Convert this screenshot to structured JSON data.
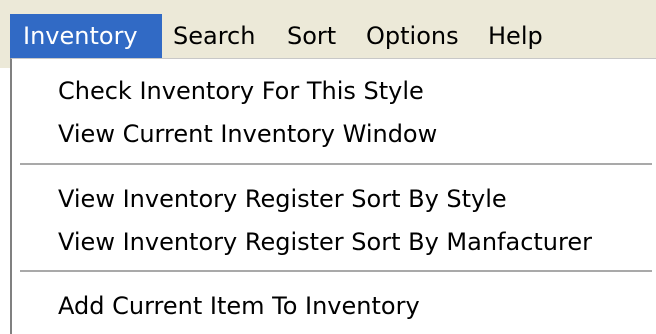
{
  "menubar": {
    "items": [
      {
        "label": "Inventory"
      },
      {
        "label": "Search"
      },
      {
        "label": "Sort"
      },
      {
        "label": "Options"
      },
      {
        "label": "Help"
      }
    ],
    "active": "Inventory"
  },
  "dropdown": {
    "items": [
      {
        "label": "Check Inventory For This Style"
      },
      {
        "label": "View Current Inventory Window"
      },
      {
        "label": "View Inventory Register Sort By Style"
      },
      {
        "label": "View Inventory Register Sort By Manfacturer"
      },
      {
        "label": "Add Current Item To Inventory"
      }
    ]
  },
  "colors": {
    "menubar_bg": "#ece9d8",
    "highlight": "#316ac5",
    "menu_bg": "#ffffff"
  }
}
